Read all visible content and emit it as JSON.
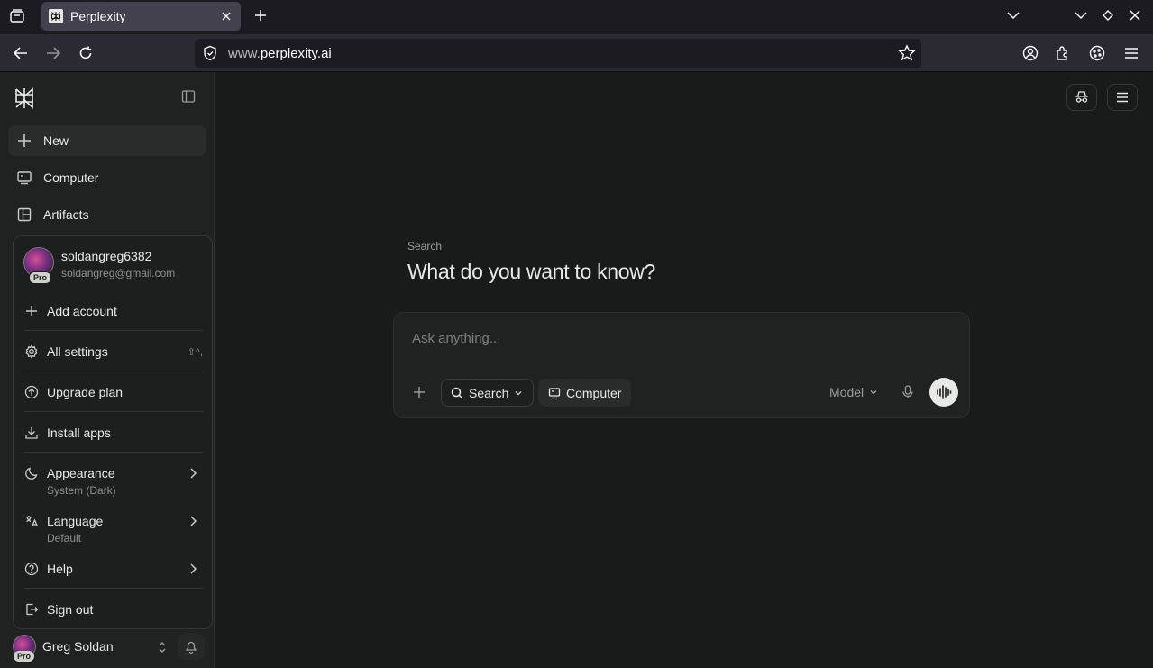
{
  "browser": {
    "tab_title": "Perplexity",
    "url_prefix": "www.",
    "url_domain": "perplexity.ai"
  },
  "sidebar": {
    "items": [
      {
        "label": "New",
        "icon": "plus-icon"
      },
      {
        "label": "Computer",
        "icon": "computer-icon"
      },
      {
        "label": "Artifacts",
        "icon": "artifacts-icon"
      }
    ]
  },
  "user_menu": {
    "username": "soldangreg6382",
    "email": "soldangreg@gmail.com",
    "badge": "Pro",
    "add_account": "Add account",
    "all_settings": "All settings",
    "all_settings_shortcut": "⇧^,",
    "upgrade_plan": "Upgrade plan",
    "install_apps": "Install apps",
    "appearance": "Appearance",
    "appearance_value": "System (Dark)",
    "language": "Language",
    "language_value": "Default",
    "help": "Help",
    "sign_out": "Sign out"
  },
  "footer": {
    "name": "Greg Soldan",
    "badge": "Pro"
  },
  "main": {
    "label": "Search",
    "title": "What do you want to know?",
    "composer": {
      "placeholder": "Ask anything...",
      "search_label": "Search",
      "computer_label": "Computer",
      "model_label": "Model"
    }
  }
}
